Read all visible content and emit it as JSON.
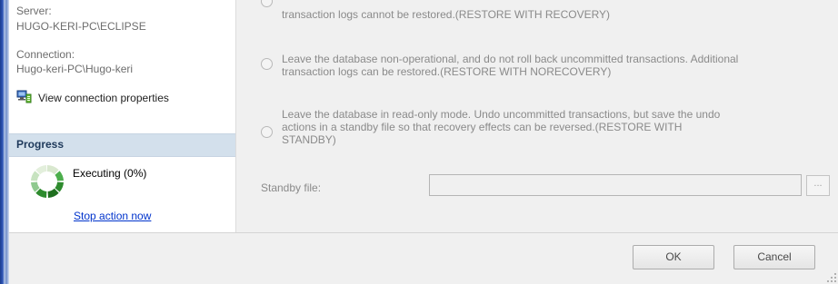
{
  "server": {
    "label": "Server:",
    "value": "HUGO-KERI-PC\\ECLIPSE"
  },
  "connection": {
    "label": "Connection:",
    "value": "Hugo-keri-PC\\Hugo-keri"
  },
  "view_connection_label": "View connection properties",
  "progress": {
    "header": "Progress",
    "status": "Executing (0%)",
    "percent": 0,
    "stop_label": "Stop action now"
  },
  "recovery_options": [
    {
      "text_lines": [
        "transaction logs cannot be restored.(RESTORE WITH RECOVERY)"
      ]
    },
    {
      "text_lines": [
        "Leave the database non-operational, and do not roll back uncommitted transactions. Additional",
        "transaction logs can be restored.(RESTORE WITH NORECOVERY)"
      ]
    },
    {
      "text_lines": [
        "Leave the database in read-only mode. Undo uncommitted transactions, but save the undo",
        "actions in a standby file so that recovery effects can be reversed.(RESTORE WITH",
        "STANDBY)"
      ]
    }
  ],
  "standby": {
    "label": "Standby file:",
    "value": "",
    "browse_label": "..."
  },
  "buttons": {
    "ok": "OK",
    "cancel": "Cancel"
  },
  "icons": {
    "connection_properties": "server-properties-icon",
    "spinner": "progress-spinner-icon"
  }
}
